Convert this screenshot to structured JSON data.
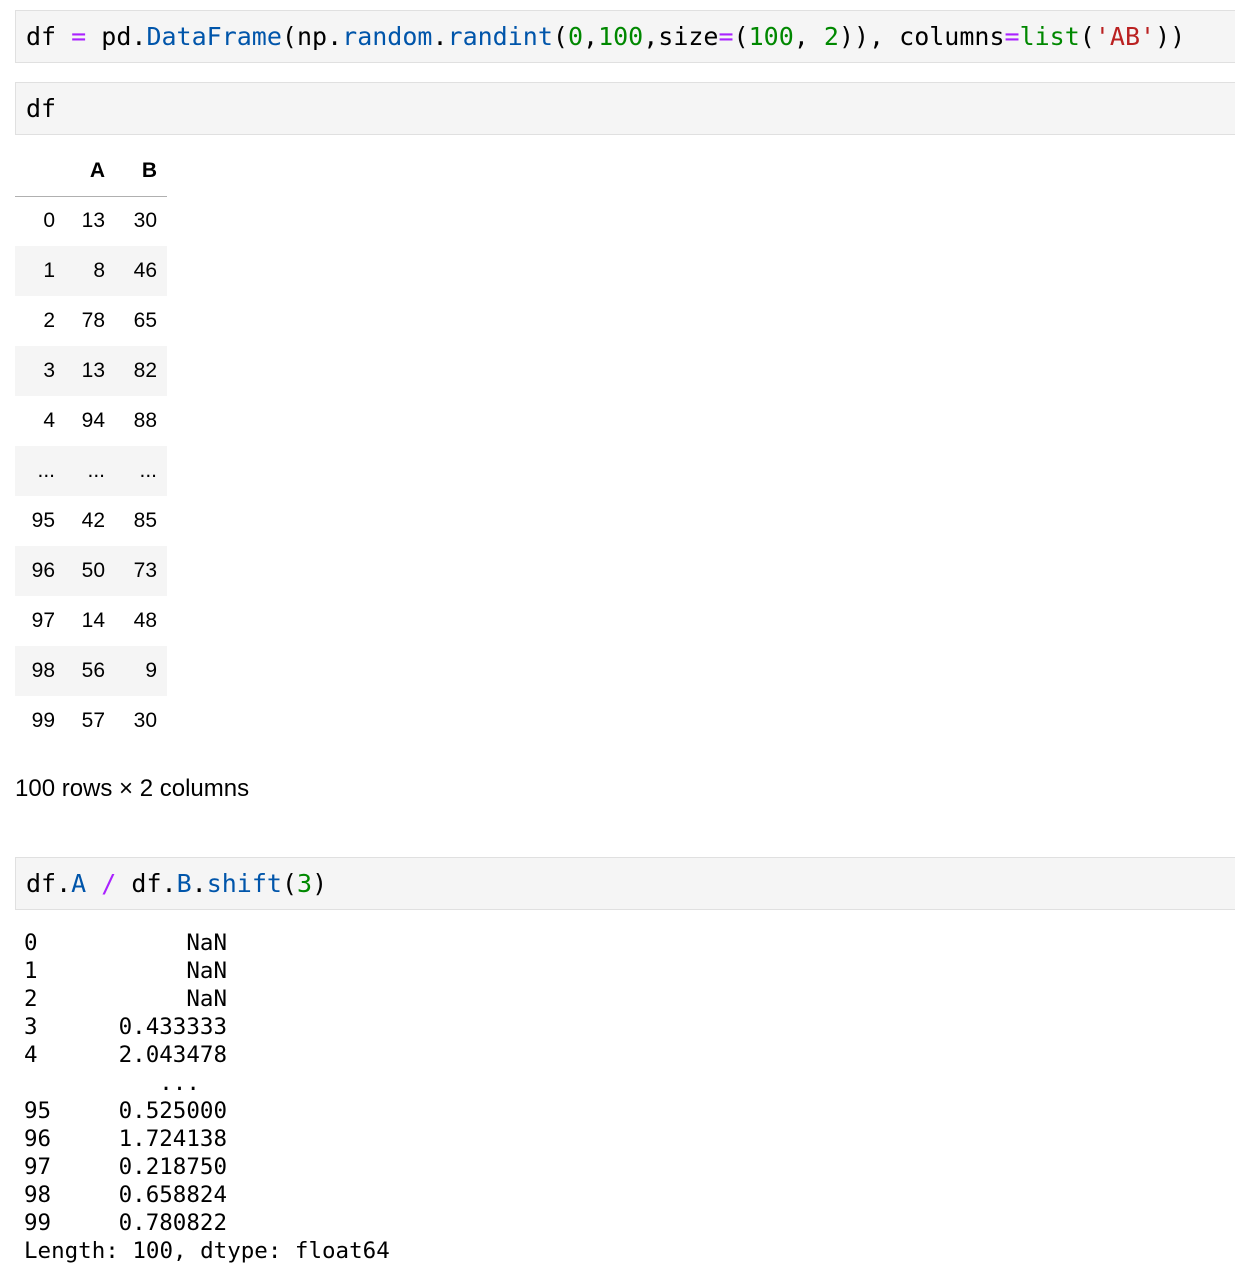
{
  "cells": [
    {
      "tokens": [
        {
          "t": "df",
          "c": "tok-var"
        },
        {
          "t": " ",
          "c": "tok-punct"
        },
        {
          "t": "=",
          "c": "tok-op"
        },
        {
          "t": " pd.",
          "c": "tok-var"
        },
        {
          "t": "DataFrame",
          "c": "tok-attr"
        },
        {
          "t": "(np.",
          "c": "tok-var"
        },
        {
          "t": "random",
          "c": "tok-attr"
        },
        {
          "t": ".",
          "c": "tok-var"
        },
        {
          "t": "randint",
          "c": "tok-attr"
        },
        {
          "t": "(",
          "c": "tok-punct"
        },
        {
          "t": "0",
          "c": "tok-num"
        },
        {
          "t": ",",
          "c": "tok-punct"
        },
        {
          "t": "100",
          "c": "tok-num"
        },
        {
          "t": ",size",
          "c": "tok-var"
        },
        {
          "t": "=",
          "c": "tok-op"
        },
        {
          "t": "(",
          "c": "tok-punct"
        },
        {
          "t": "100",
          "c": "tok-num"
        },
        {
          "t": ", ",
          "c": "tok-punct"
        },
        {
          "t": "2",
          "c": "tok-num"
        },
        {
          "t": ")), columns",
          "c": "tok-var"
        },
        {
          "t": "=",
          "c": "tok-op"
        },
        {
          "t": "list",
          "c": "tok-builtin"
        },
        {
          "t": "(",
          "c": "tok-punct"
        },
        {
          "t": "'AB'",
          "c": "tok-str"
        },
        {
          "t": "))",
          "c": "tok-punct"
        }
      ]
    },
    {
      "tokens": [
        {
          "t": "df",
          "c": "tok-var"
        }
      ]
    },
    {
      "tokens": [
        {
          "t": "df.",
          "c": "tok-var"
        },
        {
          "t": "A",
          "c": "tok-attr"
        },
        {
          "t": " ",
          "c": "tok-punct"
        },
        {
          "t": "/",
          "c": "tok-op"
        },
        {
          "t": " df.",
          "c": "tok-var"
        },
        {
          "t": "B",
          "c": "tok-attr"
        },
        {
          "t": ".",
          "c": "tok-var"
        },
        {
          "t": "shift",
          "c": "tok-attr"
        },
        {
          "t": "(",
          "c": "tok-punct"
        },
        {
          "t": "3",
          "c": "tok-num"
        },
        {
          "t": ")",
          "c": "tok-punct"
        }
      ]
    }
  ],
  "dataframe": {
    "columns": [
      "A",
      "B"
    ],
    "rows": [
      {
        "idx": "0",
        "a": "13",
        "b": "30"
      },
      {
        "idx": "1",
        "a": "8",
        "b": "46"
      },
      {
        "idx": "2",
        "a": "78",
        "b": "65"
      },
      {
        "idx": "3",
        "a": "13",
        "b": "82"
      },
      {
        "idx": "4",
        "a": "94",
        "b": "88"
      },
      {
        "idx": "...",
        "a": "...",
        "b": "..."
      },
      {
        "idx": "95",
        "a": "42",
        "b": "85"
      },
      {
        "idx": "96",
        "a": "50",
        "b": "73"
      },
      {
        "idx": "97",
        "a": "14",
        "b": "48"
      },
      {
        "idx": "98",
        "a": "56",
        "b": "9"
      },
      {
        "idx": "99",
        "a": "57",
        "b": "30"
      }
    ],
    "shape_text": "100 rows × 2 columns"
  },
  "series": {
    "rows": [
      {
        "idx": "0",
        "val": "NaN"
      },
      {
        "idx": "1",
        "val": "NaN"
      },
      {
        "idx": "2",
        "val": "NaN"
      },
      {
        "idx": "3",
        "val": "0.433333"
      },
      {
        "idx": "4",
        "val": "2.043478"
      },
      {
        "idx": "",
        "val": "...  "
      },
      {
        "idx": "95",
        "val": "0.525000"
      },
      {
        "idx": "96",
        "val": "1.724138"
      },
      {
        "idx": "97",
        "val": "0.218750"
      },
      {
        "idx": "98",
        "val": "0.658824"
      },
      {
        "idx": "99",
        "val": "0.780822"
      }
    ],
    "footer": "Length: 100, dtype: float64"
  }
}
